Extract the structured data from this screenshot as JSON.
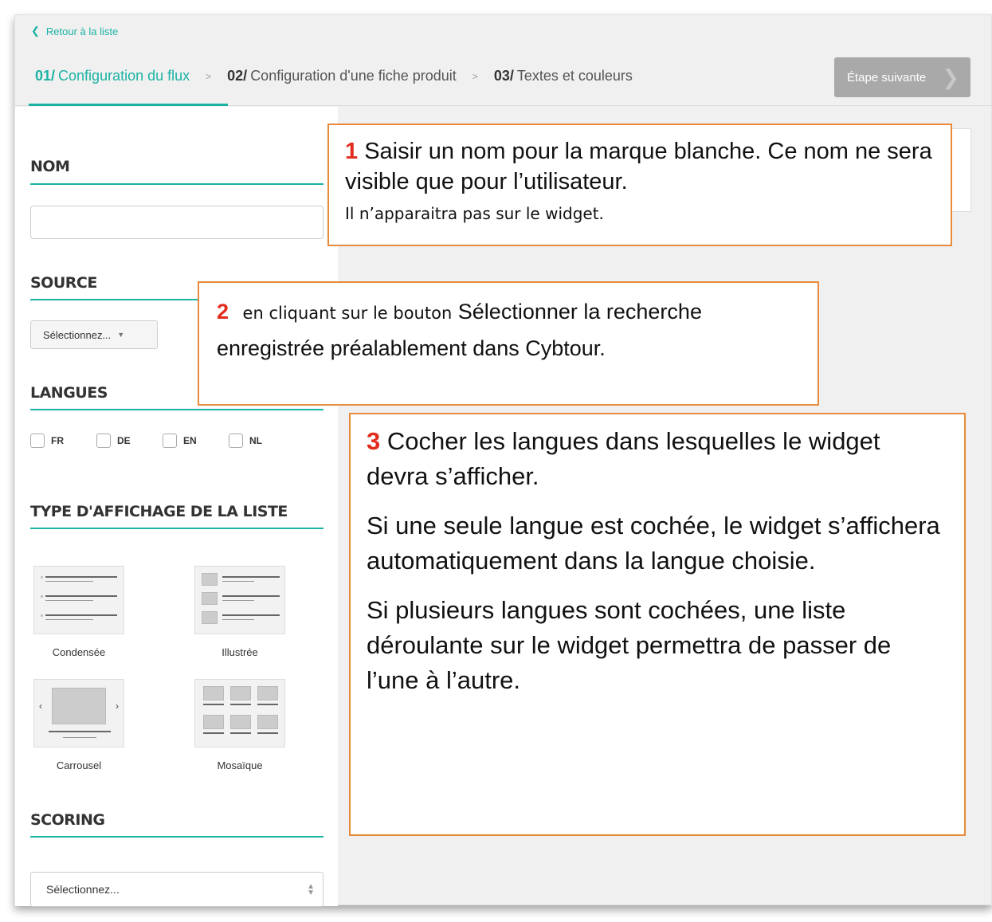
{
  "back_link": "Retour à la liste",
  "steps": [
    {
      "num": "01/",
      "name": "Configuration du flux"
    },
    {
      "num": "02/",
      "name": "Configuration d'une fiche produit"
    },
    {
      "num": "03/",
      "name": "Textes et couleurs"
    }
  ],
  "step_separator": ">",
  "next_button": "Étape suivante",
  "sections": {
    "nom": "NOM",
    "source": "SOURCE",
    "langues": "LANGUES",
    "type": "TYPE D'AFFICHAGE DE LA LISTE",
    "scoring": "SCORING"
  },
  "source_select": "Sélectionnez...",
  "languages": [
    "FR",
    "DE",
    "EN",
    "NL"
  ],
  "display_types": [
    "Condensée",
    "Illustrée",
    "Carrousel",
    "Mosaïque"
  ],
  "scoring_select": "Sélectionnez...",
  "callouts": {
    "c1_num": "1",
    "c1_text": "Saisir un nom pour la marque blanche. Ce nom ne sera visible que pour l’utilisateur.",
    "c1_small": "Il n’apparaitra pas sur le widget.",
    "c2_num": "2",
    "c2_small": "en cliquant sur le bouton",
    "c2_text": "Sélectionner la recherche enregistrée préalablement dans Cybtour.",
    "c3_num": "3",
    "c3_p1": "Cocher les langues dans lesquelles le widget devra s’afficher.",
    "c3_p2": "Si une seule langue est cochée, le widget s’affichera automatiquement dans la langue choisie.",
    "c3_p3": "Si plusieurs langues sont cochées, une liste déroulante sur le widget permettra de passer de l’une à l’autre."
  },
  "colors": {
    "accent": "#1bb3a4",
    "callout_border": "#e88a3a",
    "callout_number": "#e22c1d"
  }
}
